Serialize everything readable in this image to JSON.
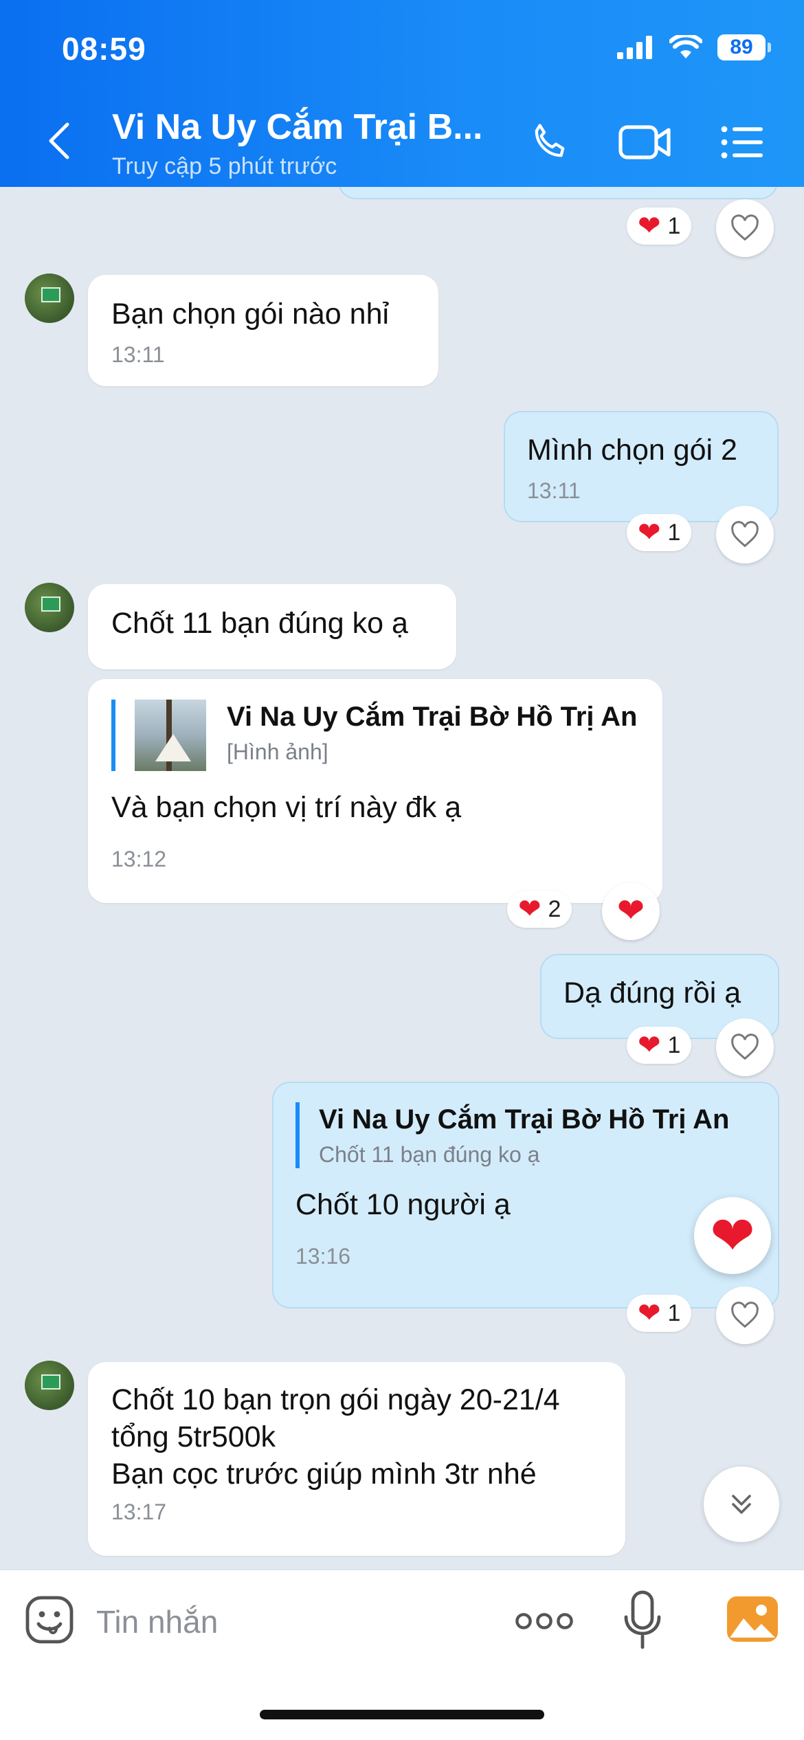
{
  "status": {
    "time": "08:59",
    "battery": "89"
  },
  "header": {
    "title": "Vi Na Uy Cắm Trại B...",
    "subtitle": "Truy cập 5 phút trước"
  },
  "messages": {
    "m1": {
      "text": "Bạn chọn gói nào nhỉ",
      "time": "13:11"
    },
    "m2": {
      "text": "Mình chọn gói 2",
      "time": "13:11",
      "reactions": "1"
    },
    "m3": {
      "text": "Chốt 11 bạn đúng ko ạ"
    },
    "m4": {
      "quote_name": "Vi Na Uy Cắm Trại Bờ Hồ Trị An",
      "quote_text": "[Hình ảnh]",
      "text": "Và bạn chọn vị trí này đk ạ",
      "time": "13:12",
      "reactions": "2"
    },
    "m5": {
      "text": "Dạ đúng rồi ạ",
      "reactions": "1"
    },
    "m6": {
      "quote_name": "Vi Na Uy Cắm Trại Bờ Hồ Trị An",
      "quote_text": "Chốt 11 bạn đúng ko ạ",
      "text": "Chốt 10 người ạ",
      "time": "13:16",
      "reactions": "1"
    },
    "m7": {
      "line1": "Chốt 10 bạn trọn gói ngày 20-21/4",
      "line2": "tổng 5tr500k",
      "line3": "Bạn cọc trước giúp mình 3tr nhé",
      "time": "13:17"
    },
    "m0": {
      "reactions": "1"
    }
  },
  "composer": {
    "placeholder": "Tin nhắn"
  },
  "colors": {
    "header": "#0a6ff0",
    "outgoing_bubble": "#d3ecfb",
    "incoming_bubble": "#ffffff",
    "background": "#e2e8f0",
    "heart": "#e8192c"
  }
}
